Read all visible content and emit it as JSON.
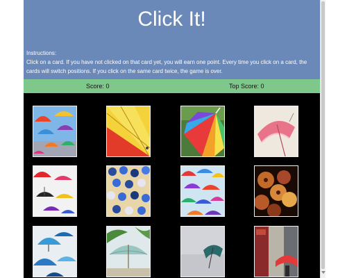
{
  "game": {
    "title": "Click It!",
    "instructions_heading": "Instructions:",
    "instructions_text": "Click on a card. If you have not clicked on that card yet, you will earn one point. Every time you click on a card, the cards will switch positions. If you click on the same card twice, the game is over.",
    "score_text": "Score: 0",
    "top_score_text": "Top Score: 0"
  },
  "colors": {
    "header_bg": "#6a89b8",
    "scorebar_bg": "#7dc88a",
    "board_bg": "#000000"
  },
  "cards": [
    {
      "name": "card-umbrellas-sky",
      "image": "colorful umbrellas hanging against sky"
    },
    {
      "name": "card-red-yellow-umbrella",
      "image": "red and yellow umbrella close-up"
    },
    {
      "name": "card-rainbow-umbrella",
      "image": "rainbow striped umbrella"
    },
    {
      "name": "card-pink-lace-umbrella",
      "image": "pink lace umbrella"
    },
    {
      "name": "card-floating-umbrellas",
      "image": "colorful umbrellas floating over white"
    },
    {
      "name": "card-beach-umbrellas",
      "image": "striped beach umbrellas from above"
    },
    {
      "name": "card-umbrella-canopy",
      "image": "canopy of multicolored umbrellas"
    },
    {
      "name": "card-paper-lantern-umbrellas",
      "image": "paper umbrellas at night"
    },
    {
      "name": "card-blue-umbrellas-sky",
      "image": "blue umbrellas against pale sky"
    },
    {
      "name": "card-palm-umbrella",
      "image": "patio umbrella with palm trees"
    },
    {
      "name": "card-teal-umbrella-fog",
      "image": "teal umbrella in fog"
    },
    {
      "name": "card-street-red-umbrella",
      "image": "red umbrella on city street"
    }
  ]
}
